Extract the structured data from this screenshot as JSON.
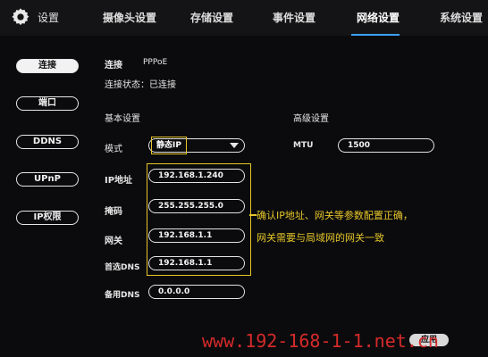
{
  "header": {
    "app_title": "设置",
    "tabs": [
      {
        "label": "摄像头设置"
      },
      {
        "label": "存储设置"
      },
      {
        "label": "事件设置"
      },
      {
        "label": "网络设置"
      },
      {
        "label": "系统设置"
      }
    ],
    "active_tab": "网络设置"
  },
  "sidebar": {
    "items": [
      {
        "label": "连接",
        "active": true
      },
      {
        "label": "端口"
      },
      {
        "label": "DDNS"
      },
      {
        "label": "UPnP"
      },
      {
        "label": "IP权限"
      }
    ]
  },
  "main": {
    "connection_label": "连接",
    "connection_value": "PPPoE",
    "status_text": "连接状态：已连接",
    "basic_section": "基本设置",
    "advanced_section": "高级设置",
    "mode_label": "模式",
    "mode_value": "静态IP",
    "mtu_label": "MTU",
    "mtu_value": "1500",
    "fields": [
      {
        "label": "IP地址",
        "value": "192.168.1.240"
      },
      {
        "label": "掩码",
        "value": "255.255.255.0"
      },
      {
        "label": "网关",
        "value": "192.168.1.1"
      },
      {
        "label": "首选DNS",
        "value": "192.168.1.1"
      },
      {
        "label": "备用DNS",
        "value": "0.0.0.0"
      }
    ],
    "annotation_line1": "确认IP地址、网关等参数配置正确，",
    "annotation_line2": "网关需要与局域网的网关一致"
  },
  "footer": {
    "watermark": "www.192-168-1-1.net.cn",
    "apply_label": "应用"
  },
  "colors": {
    "highlight": "#e6c62a",
    "watermark": "#d42a2a",
    "active_underline": "#3aa0ff"
  }
}
